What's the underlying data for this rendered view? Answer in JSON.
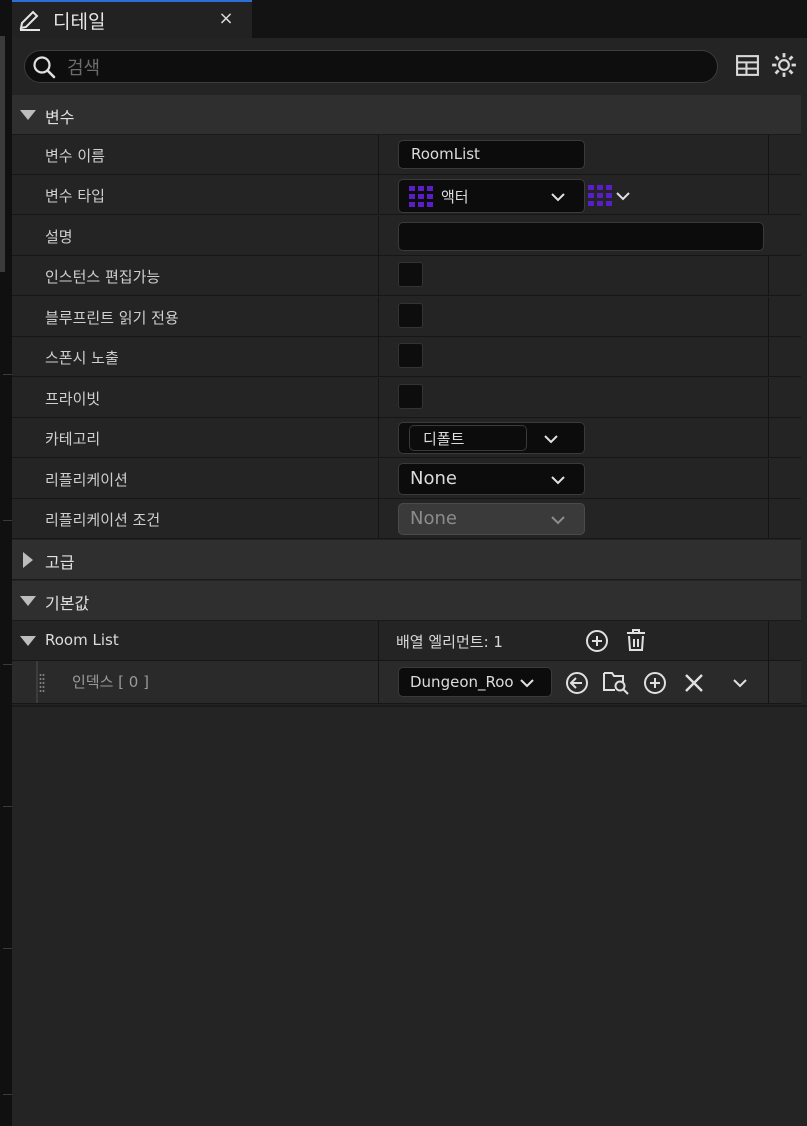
{
  "tab": {
    "title": "디테일",
    "close": "×"
  },
  "search": {
    "placeholder": "검색"
  },
  "sections": {
    "variables": "변수",
    "advanced": "고급",
    "defaults": "기본값"
  },
  "rows": {
    "var_name": {
      "label": "변수 이름",
      "value": "RoomList"
    },
    "var_type": {
      "label": "변수 타입",
      "value": "액터"
    },
    "description": {
      "label": "설명",
      "value": ""
    },
    "instance_editable": {
      "label": "인스턴스 편집가능"
    },
    "blueprint_readonly": {
      "label": "블루프린트 읽기 전용"
    },
    "expose_spawn": {
      "label": "스폰시 노출"
    },
    "private": {
      "label": "프라이빗"
    },
    "category": {
      "label": "카테고리",
      "value": "디폴트"
    },
    "replication": {
      "label": "리플리케이션",
      "value": "None"
    },
    "replication_condition": {
      "label": "리플리케이션 조건",
      "value": "None"
    }
  },
  "array": {
    "label": "Room List",
    "elements": "배열 엘리먼트: 1",
    "index_label": "인덱스 [ 0 ]",
    "index_value": "Dungeon_Room"
  },
  "colors": {
    "accent_tab": "#2a6fd6",
    "object_purple": "#5a1ec8"
  }
}
